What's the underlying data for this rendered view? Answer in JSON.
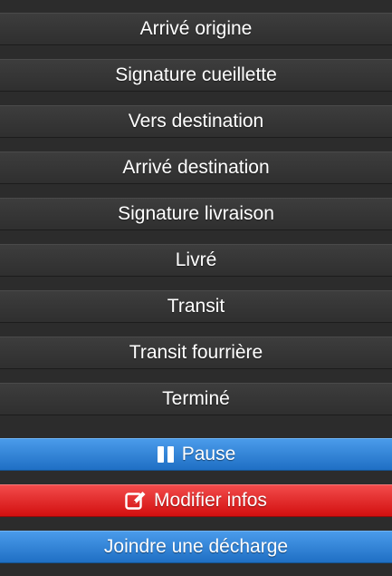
{
  "status_buttons": [
    {
      "label": "Arrivé origine"
    },
    {
      "label": "Signature cueillette"
    },
    {
      "label": "Vers destination"
    },
    {
      "label": "Arrivé destination"
    },
    {
      "label": "Signature livraison"
    },
    {
      "label": "Livré"
    },
    {
      "label": "Transit"
    },
    {
      "label": "Transit fourrière"
    },
    {
      "label": "Terminé"
    }
  ],
  "actions": {
    "pause": {
      "label": "Pause",
      "icon": "pause-icon",
      "color": "#2a7fd4"
    },
    "modify": {
      "label": "Modifier infos",
      "icon": "edit-icon",
      "color": "#e21c1c"
    },
    "attach": {
      "label": "Joindre une décharge",
      "color": "#2a7fd4"
    }
  }
}
